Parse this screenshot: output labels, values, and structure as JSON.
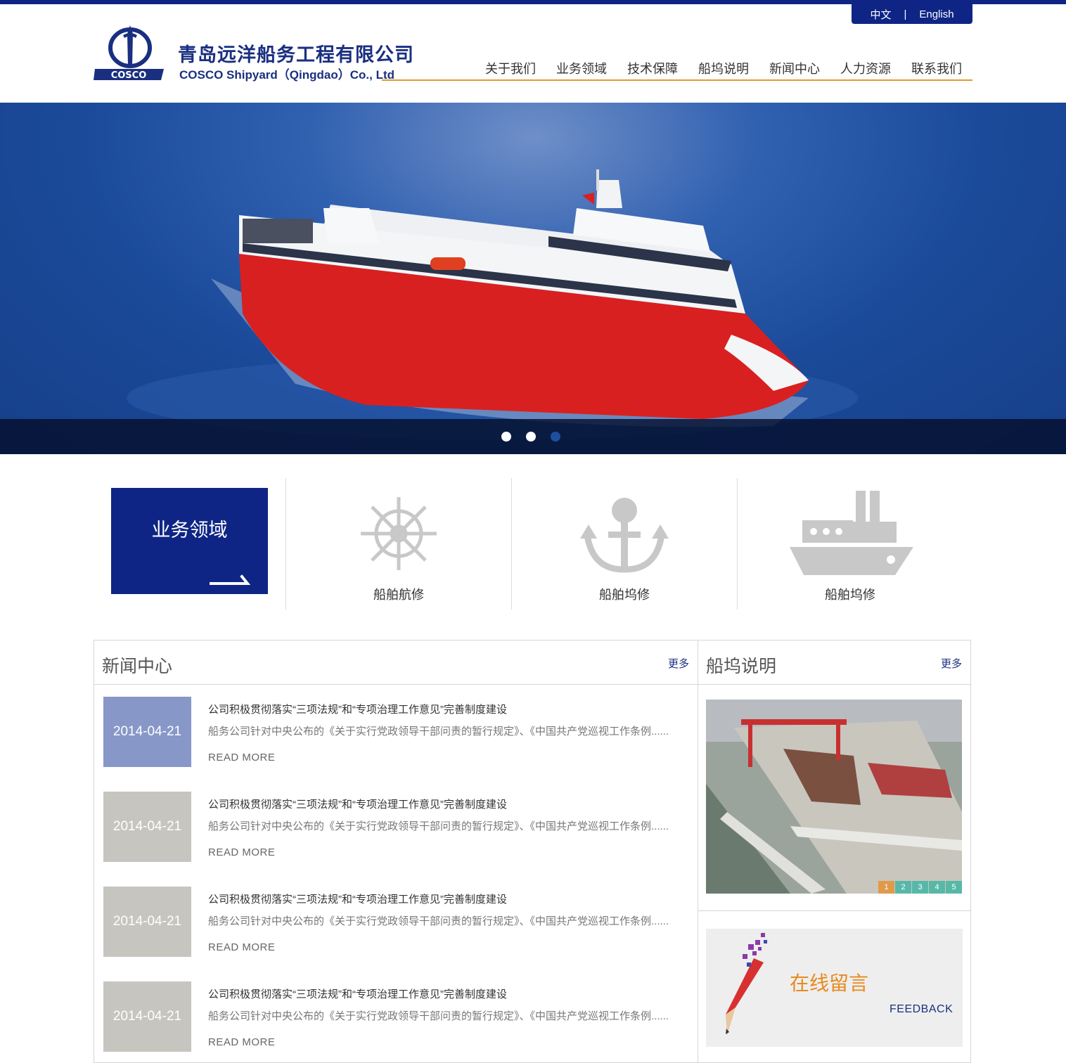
{
  "header": {
    "lang": {
      "cn": "中文",
      "sep": "|",
      "en": "English"
    },
    "logo": {
      "name_cn": "青岛远洋船务工程有限公司",
      "name_en": "COSCO Shipyard（Qingdao）Co., Ltd",
      "mark_text": "COSCO"
    },
    "nav": [
      "关于我们",
      "业务领域",
      "技术保障",
      "船坞说明",
      "新闻中心",
      "人力资源",
      "联系我们"
    ]
  },
  "banner": {
    "slides": 3,
    "active_slide": 3
  },
  "business": {
    "box_title": "业务领域",
    "services": [
      {
        "label": "船舶航修",
        "icon": "ship-wheel-icon"
      },
      {
        "label": "船舶坞修",
        "icon": "anchor-icon"
      },
      {
        "label": "船舶坞修",
        "icon": "ship-icon"
      }
    ]
  },
  "news": {
    "title": "新闻中心",
    "more": "更多",
    "items": [
      {
        "date": "2014-04-21",
        "title": "公司积极贯彻落实“三项法规”和“专项治理工作意见”完善制度建设",
        "desc": "船务公司针对中央公布的《关于实行党政领导干部问责的暂行规定》、《中国共产党巡视工作条例......",
        "more": "READ MORE"
      },
      {
        "date": "2014-04-21",
        "title": "公司积极贯彻落实“三项法规”和“专项治理工作意见”完善制度建设",
        "desc": "船务公司针对中央公布的《关于实行党政领导干部问责的暂行规定》、《中国共产党巡视工作条例......",
        "more": "READ MORE"
      },
      {
        "date": "2014-04-21",
        "title": "公司积极贯彻落实“三项法规”和“专项治理工作意见”完善制度建设",
        "desc": "船务公司针对中央公布的《关于实行党政领导干部问责的暂行规定》、《中国共产党巡视工作条例......",
        "more": "READ MORE"
      },
      {
        "date": "2014-04-21",
        "title": "公司积极贯彻落实“三项法规”和“专项治理工作意见”完善制度建设",
        "desc": "船务公司针对中央公布的《关于实行党政领导干部问责的暂行规定》、《中国共产党巡视工作条例......",
        "more": "READ MORE"
      }
    ]
  },
  "dock": {
    "title": "船坞说明",
    "more": "更多",
    "pages": [
      "1",
      "2",
      "3",
      "4",
      "5"
    ],
    "active_page": "1"
  },
  "feedback": {
    "cn": "在线留言",
    "en": "FEEDBACK"
  },
  "colors": {
    "brand": "#0e2586",
    "accent": "#e09a2e",
    "date_highlight": "#8797c7",
    "date_normal": "#c7c5c0",
    "feedback": "#e88a1e"
  }
}
